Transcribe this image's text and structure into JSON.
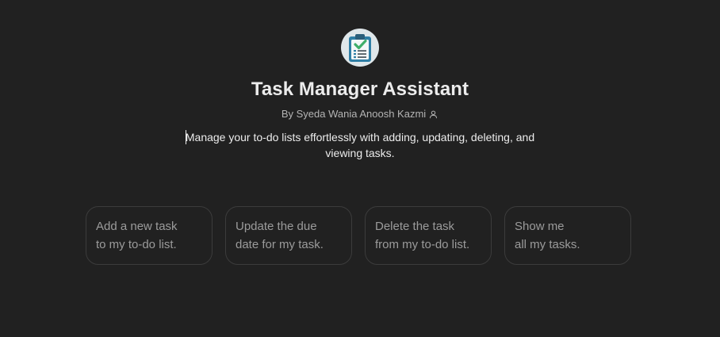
{
  "gpt": {
    "title": "Task Manager Assistant",
    "author": "By Syeda Wania Anoosh Kazmi",
    "author_icon": "person-icon",
    "avatar_icon": "clipboard-checklist-icon",
    "description": "Manage your to-do lists effortlessly with adding, updating, deleting, and viewing tasks."
  },
  "starters": [
    {
      "label": "Add a new task\nto my to-do list."
    },
    {
      "label": "Update the due\ndate for my task."
    },
    {
      "label": "Delete the task\nfrom my to-do list."
    },
    {
      "label": "Show me\nall my tasks."
    }
  ],
  "colors": {
    "background": "#212121",
    "text": "#ececec",
    "muted": "#b4b4b4",
    "starter_text": "#9b9b9b",
    "starter_border": "#3c3c3c",
    "avatar_bg": "#dfe7ea",
    "clipboard": "#3b8fb5",
    "check": "#3fae6a"
  }
}
